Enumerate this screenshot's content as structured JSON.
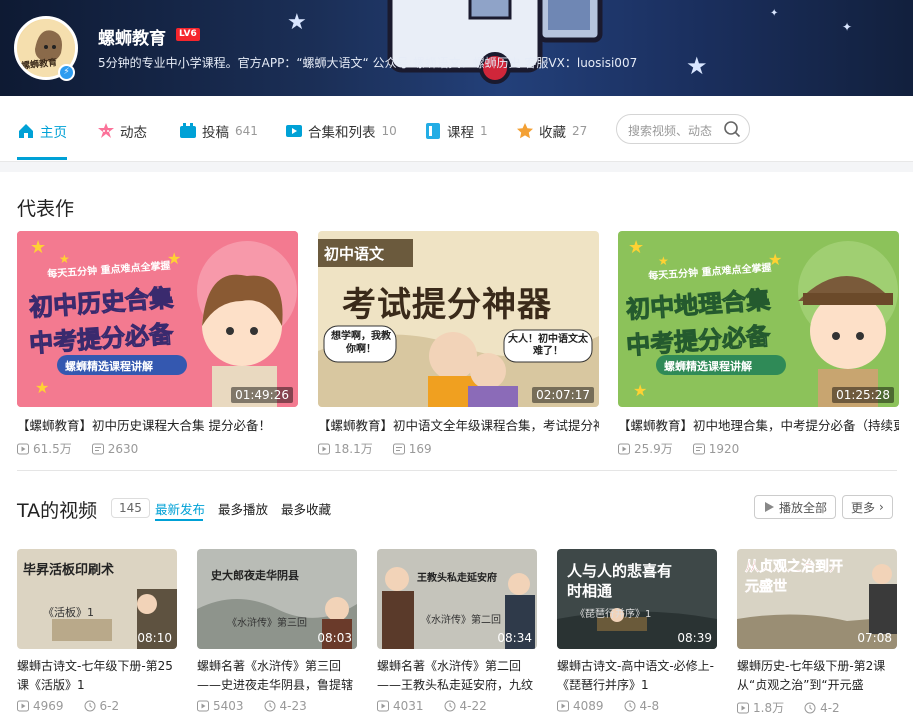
{
  "profile": {
    "name": "螺蛳教育",
    "level": "LV6",
    "avatar_text": "螺蛳教育",
    "sign": "5分钟的专业中小学课程。官方APP：“螺蛳大语文“ 公众号:螺蛳语文、螺蛳历史 客服VX：luosisi007"
  },
  "nav": {
    "items": [
      {
        "label": "主页",
        "count": "",
        "icon": "home-icon"
      },
      {
        "label": "动态",
        "count": "",
        "icon": "dynamic-icon"
      },
      {
        "label": "投稿",
        "count": "641",
        "icon": "upload-icon"
      },
      {
        "label": "合集和列表",
        "count": "10",
        "icon": "collection-icon"
      },
      {
        "label": "课程",
        "count": "1",
        "icon": "course-icon"
      },
      {
        "label": "收藏",
        "count": "27",
        "icon": "favorite-icon"
      }
    ],
    "search_placeholder": "搜索视频、动态"
  },
  "featured": {
    "title": "代表作",
    "items": [
      {
        "title": "【螺蛳教育】初中历史课程大合集 提分必备！",
        "duration": "01:49:26",
        "views": "61.5万",
        "danmaku": "2630",
        "thumb_lines": [
          "初中历史合集",
          "中考提分必备"
        ],
        "thumb_tag": "每天五分钟 重点难点全掌握",
        "thumb_footer": "螺蛳精选课程讲解"
      },
      {
        "title": "【螺蛳教育】初中语文全年级课程合集，考试提分神",
        "duration": "02:07:17",
        "views": "18.1万",
        "danmaku": "169",
        "thumb_lines": [
          "考试提分神器"
        ],
        "thumb_tag": "初中语文",
        "thumb_footer": "想学啊，我教你啊！",
        "thumb_bubble": "大人！初中语文太难了！"
      },
      {
        "title": "【螺蛳教育】初中地理合集，中考提分必备（持续更",
        "duration": "01:25:28",
        "views": "25.9万",
        "danmaku": "1920",
        "thumb_lines": [
          "初中地理合集",
          "中考提分必备"
        ],
        "thumb_tag": "每天五分钟 重点难点全掌握",
        "thumb_footer": "螺蛳精选课程讲解"
      }
    ]
  },
  "videos": {
    "title": "TA的视频",
    "count": "145",
    "sort_tabs": [
      "最新发布",
      "最多播放",
      "最多收藏"
    ],
    "play_all": "播放全部",
    "more": "更多",
    "items": [
      {
        "title": "螺蛳古诗文-七年级下册-第25课《活版》1",
        "duration": "08:10",
        "views": "4969",
        "date": "6-2",
        "thumb_text": "毕昇活板印刷术",
        "thumb_sub": "《活板》1"
      },
      {
        "title": "螺蛳名著《水浒传》第三回——史进夜走华阴县，鲁提辖",
        "duration": "08:03",
        "views": "5403",
        "date": "4-23",
        "thumb_text": "史大郎夜走华阴县",
        "thumb_sub": "《水浒传》第三回"
      },
      {
        "title": "螺蛳名著《水浒传》第二回——王教头私走延安府，九纹",
        "duration": "08:34",
        "views": "4031",
        "date": "4-22",
        "thumb_text": "王教头私走延安府",
        "thumb_sub": "《水浒传》第二回"
      },
      {
        "title": "螺蛳古诗文-高中语文-必修上-《琵琶行并序》1",
        "duration": "08:39",
        "views": "4089",
        "date": "4-8",
        "thumb_text": "人与人的悲喜有时相通",
        "thumb_sub": "《琵琶行并序》1"
      },
      {
        "title": "螺蛳历史-七年级下册-第2课从“贞观之治”到“开元盛",
        "duration": "07:08",
        "views": "1.8万",
        "date": "4-2",
        "thumb_text": "从贞观之治到开元盛世",
        "thumb_sub": ""
      }
    ]
  },
  "colors": {
    "accent": "#00a1d6",
    "level_badge": "#f5262d"
  }
}
